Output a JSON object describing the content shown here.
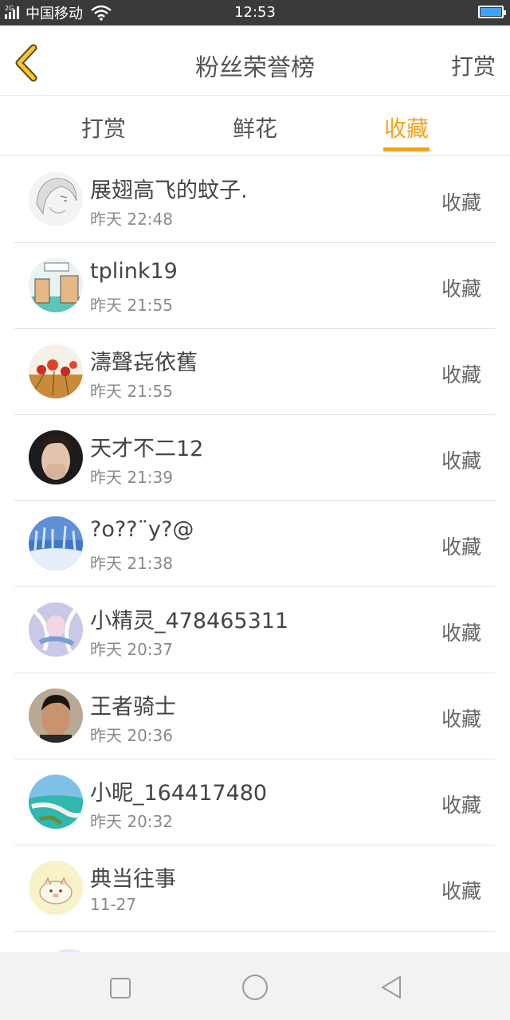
{
  "status_bar": {
    "network_tag": "2G",
    "carrier": "中国移动",
    "time": "12:53",
    "battery_color": "#3ea3f7"
  },
  "header": {
    "back_icon": "chevron-left-icon",
    "title": "粉丝荣誉榜",
    "action": "打赏"
  },
  "tabs": [
    {
      "label": "打赏",
      "active": false
    },
    {
      "label": "鲜花",
      "active": false
    },
    {
      "label": "收藏",
      "active": true
    }
  ],
  "accent_color": "#f5a31b",
  "fans": [
    {
      "name": "展翅高飞的蚊子.",
      "time": "昨天 22:48",
      "action": "收藏"
    },
    {
      "name": "tplink19",
      "time": "昨天 21:55",
      "action": "收藏"
    },
    {
      "name": "濤聲㐂依舊",
      "time": "昨天 21:55",
      "action": "收藏"
    },
    {
      "name": "天才不二12",
      "time": "昨天 21:39",
      "action": "收藏"
    },
    {
      "name": "?o??¨y?@",
      "time": "昨天 21:38",
      "action": "收藏"
    },
    {
      "name": "小精灵_478465311",
      "time": "昨天 20:37",
      "action": "收藏"
    },
    {
      "name": "王者骑士",
      "time": "昨天 20:36",
      "action": "收藏"
    },
    {
      "name": "小昵_164417480",
      "time": "昨天 20:32",
      "action": "收藏"
    },
    {
      "name": "典当往事",
      "time": "11-27",
      "action": "收藏"
    }
  ],
  "nav_bar": {
    "items": [
      "square-recents-icon",
      "circle-home-icon",
      "triangle-back-icon"
    ]
  }
}
